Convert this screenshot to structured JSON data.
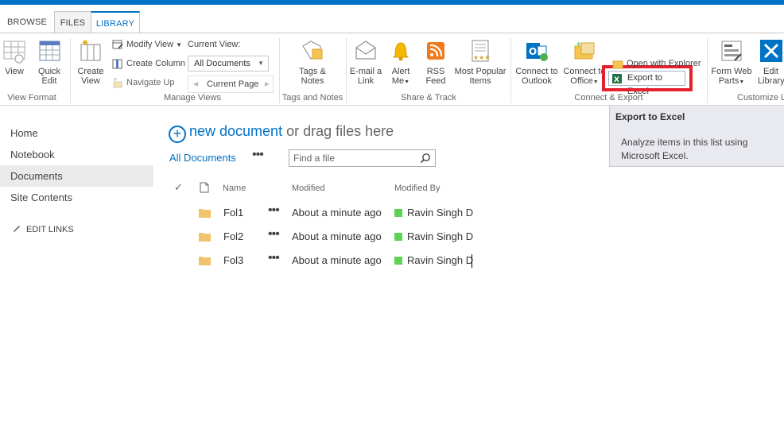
{
  "tabs": [
    {
      "label": "BROWSE"
    },
    {
      "label": "FILES"
    },
    {
      "label": "LIBRARY"
    }
  ],
  "ribbon": {
    "view_format": {
      "view_label": "View",
      "quick_edit_label_1": "Quick",
      "quick_edit_label_2": "Edit",
      "group_label": "View Format"
    },
    "manage_views": {
      "create_view_1": "Create",
      "create_view_2": "View",
      "modify_view": "Modify View",
      "create_column": "Create Column",
      "navigate_up": "Navigate Up",
      "current_view_label": "Current View:",
      "current_view_value": "All Documents",
      "current_page": "Current Page",
      "group_label": "Manage Views"
    },
    "tags_notes": {
      "label_1": "Tags &",
      "label_2": "Notes",
      "group_label": "Tags and Notes"
    },
    "share_track": {
      "email_1": "E-mail a",
      "email_2": "Link",
      "alert_1": "Alert",
      "alert_2": "Me",
      "rss_1": "RSS",
      "rss_2": "Feed",
      "popular_1": "Most Popular",
      "popular_2": "Items",
      "group_label": "Share & Track"
    },
    "connect_export": {
      "outlook_1": "Connect to",
      "outlook_2": "Outlook",
      "office_1": "Connect to",
      "office_2": "Office",
      "export_excel": "Export to Excel",
      "open_explorer": "Open with Explorer",
      "group_label": "Connect & Export"
    },
    "customize": {
      "form_web_1": "Form Web",
      "form_web_2": "Parts",
      "edit_lib_1": "Edit",
      "edit_lib_2": "Library",
      "group_label": "Customize Li"
    }
  },
  "tooltip": {
    "title": "Export to Excel",
    "body": "Analyze items in this list using Microsoft Excel."
  },
  "nav": {
    "items": [
      "Home",
      "Notebook",
      "Documents",
      "Site Contents"
    ],
    "edit_links": "EDIT LINKS"
  },
  "main": {
    "new_document": "new document",
    "drag_text": "or drag files here",
    "view_name": "All Documents",
    "find_placeholder": "Find a file",
    "columns": {
      "name": "Name",
      "modified": "Modified",
      "modified_by": "Modified By"
    },
    "rows": [
      {
        "name": "Fol1",
        "modified": "About a minute ago",
        "modified_by": "Ravin Singh D"
      },
      {
        "name": "Fol2",
        "modified": "About a minute ago",
        "modified_by": "Ravin Singh D"
      },
      {
        "name": "Fol3",
        "modified": "About a minute ago",
        "modified_by": "Ravin Singh D"
      }
    ]
  }
}
